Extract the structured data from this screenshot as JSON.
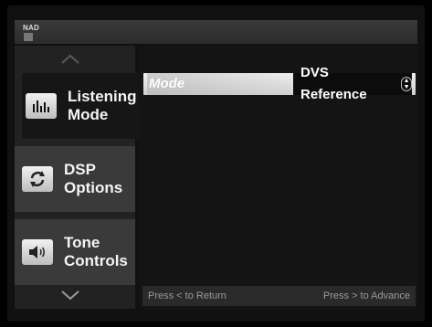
{
  "brand": "NAD",
  "menu": {
    "items": [
      {
        "label": "Listening\nMode",
        "icon": "bar-graph-icon",
        "active": true
      },
      {
        "label": "DSP\nOptions",
        "icon": "refresh-icon",
        "active": false
      },
      {
        "label": "Tone\nControls",
        "icon": "speaker-icon",
        "active": false
      }
    ]
  },
  "setting": {
    "label": "Mode",
    "value": "DVS Reference"
  },
  "footer": {
    "return_hint": "Press < to Return",
    "advance_hint": "Press > to Advance"
  }
}
